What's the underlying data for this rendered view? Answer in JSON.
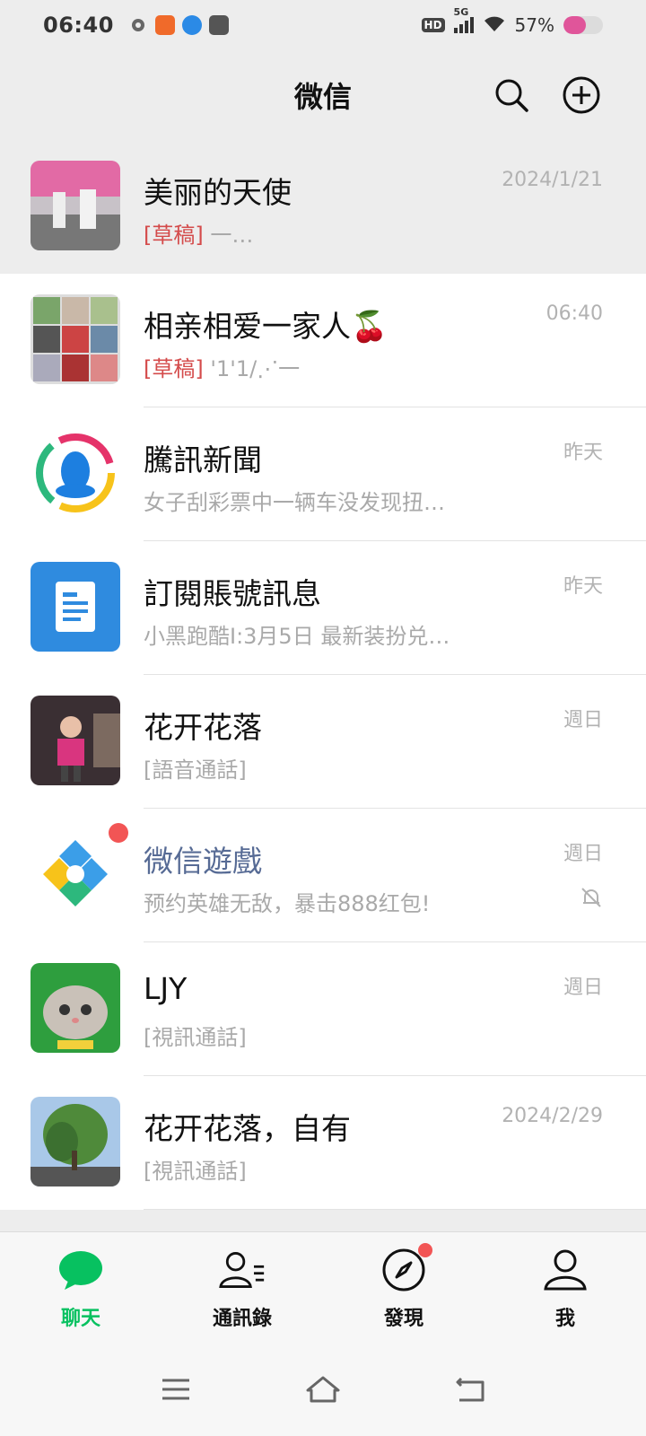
{
  "status_bar": {
    "time": "06:40",
    "network": "5G",
    "hd_badge": "HD",
    "battery_text": "57%",
    "battery_level": 0.57
  },
  "header": {
    "title": "微信",
    "search_icon": "search-icon",
    "add_icon": "plus-circle-icon"
  },
  "chats": [
    {
      "name": "美丽的天使",
      "draft_tag": "[草稿]",
      "preview": " 一…",
      "time": "2024/1/21",
      "pinned": true
    },
    {
      "name": "相亲相爱一家人🍒",
      "draft_tag": "[草稿]",
      "preview": " '1'1/⋰一",
      "time": "06:40"
    },
    {
      "name": "騰訊新聞",
      "preview": "女子刮彩票中一辆车没发现扭…",
      "time": "昨天"
    },
    {
      "name": "訂閱賬號訊息",
      "preview": "小黑跑酷I:3月5日 最新装扮兑…",
      "time": "昨天"
    },
    {
      "name": "花开花落",
      "preview": "[語音通話]",
      "time": "週日"
    },
    {
      "name": "微信遊戲",
      "preview": "预约英雄无敌，暴击888红包!",
      "time": "週日",
      "muted": true,
      "unread_dot": true
    },
    {
      "name": "LJY",
      "preview": "[視訊通話]",
      "time": "週日"
    },
    {
      "name": "花开花落，自有",
      "preview": "[視訊通話]",
      "time": "2024/2/29"
    }
  ],
  "bottom_nav": [
    {
      "label": "聊天",
      "icon": "chat-bubble-icon",
      "active": true
    },
    {
      "label": "通訊錄",
      "icon": "contacts-icon"
    },
    {
      "label": "發現",
      "icon": "compass-icon",
      "dot": true
    },
    {
      "label": "我",
      "icon": "person-icon"
    }
  ],
  "colors": {
    "accent": "#07c160",
    "draft": "#d44b4b",
    "service_name": "#576b95",
    "badge": "#f25555"
  }
}
